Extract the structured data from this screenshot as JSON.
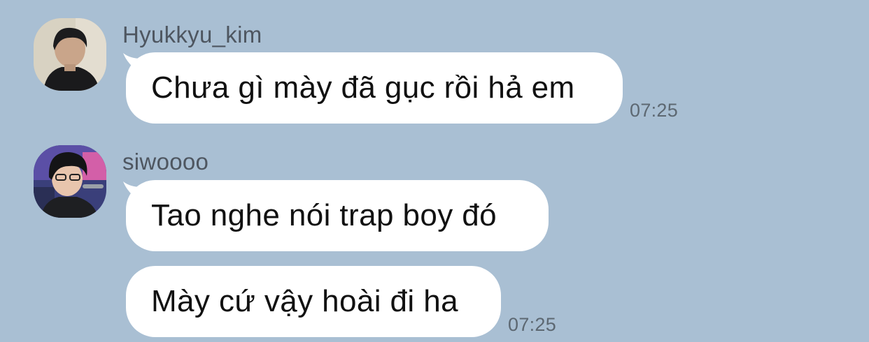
{
  "messages": [
    {
      "sender": "Hyukkyu_kim",
      "avatar_icon": "user-photo-avatar",
      "bubbles": [
        {
          "text": "Chưa gì mày đã gục rồi hả em",
          "time": "07:25"
        }
      ]
    },
    {
      "sender": "siwoooo",
      "avatar_icon": "user-photo-avatar",
      "bubbles": [
        {
          "text": "Tao nghe nói trap boy đó",
          "time": ""
        },
        {
          "text": "Mày cứ vậy hoài đi ha",
          "time": "07:25"
        }
      ]
    }
  ],
  "colors": {
    "background": "#a9bfd3",
    "bubble": "#ffffff",
    "sender_name": "#4e5660",
    "timestamp": "#5d6872"
  }
}
